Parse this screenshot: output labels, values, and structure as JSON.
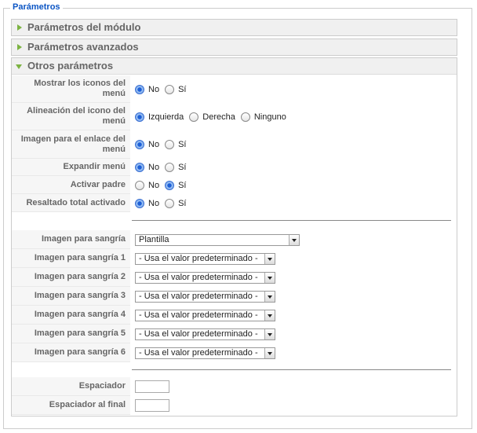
{
  "legend": "Parámetros",
  "panels": {
    "module": "Parámetros del módulo",
    "advanced": "Parámetros avanzados",
    "other": "Otros parámetros"
  },
  "rows": [
    {
      "label": "Mostrar los iconos del menú",
      "options": [
        "No",
        "Sí"
      ],
      "selected": "No"
    },
    {
      "label": "Alineación del icono del menú",
      "options": [
        "Izquierda",
        "Derecha",
        "Ninguno"
      ],
      "selected": "Izquierda"
    },
    {
      "label": "Imagen para el enlace del menú",
      "options": [
        "No",
        "Sí"
      ],
      "selected": "No"
    },
    {
      "label": "Expandir menú",
      "options": [
        "No",
        "Sí"
      ],
      "selected": "No"
    },
    {
      "label": "Activar padre",
      "options": [
        "No",
        "Sí"
      ],
      "selected": "Sí"
    },
    {
      "label": "Resaltado total activado",
      "options": [
        "No",
        "Sí"
      ],
      "selected": "No"
    }
  ],
  "indent": {
    "label": "Imagen para sangría",
    "value": "Plantilla"
  },
  "indents": [
    {
      "label": "Imagen para sangría 1",
      "value": "- Usa el valor predeterminado -"
    },
    {
      "label": "Imagen para sangría 2",
      "value": "- Usa el valor predeterminado -"
    },
    {
      "label": "Imagen para sangría 3",
      "value": "- Usa el valor predeterminado -"
    },
    {
      "label": "Imagen para sangría 4",
      "value": "- Usa el valor predeterminado -"
    },
    {
      "label": "Imagen para sangría 5",
      "value": "- Usa el valor predeterminado -"
    },
    {
      "label": "Imagen para sangría 6",
      "value": "- Usa el valor predeterminado -"
    }
  ],
  "spacer": {
    "label": "Espaciador",
    "value": ""
  },
  "end_spacer": {
    "label": "Espaciador al final",
    "value": ""
  }
}
